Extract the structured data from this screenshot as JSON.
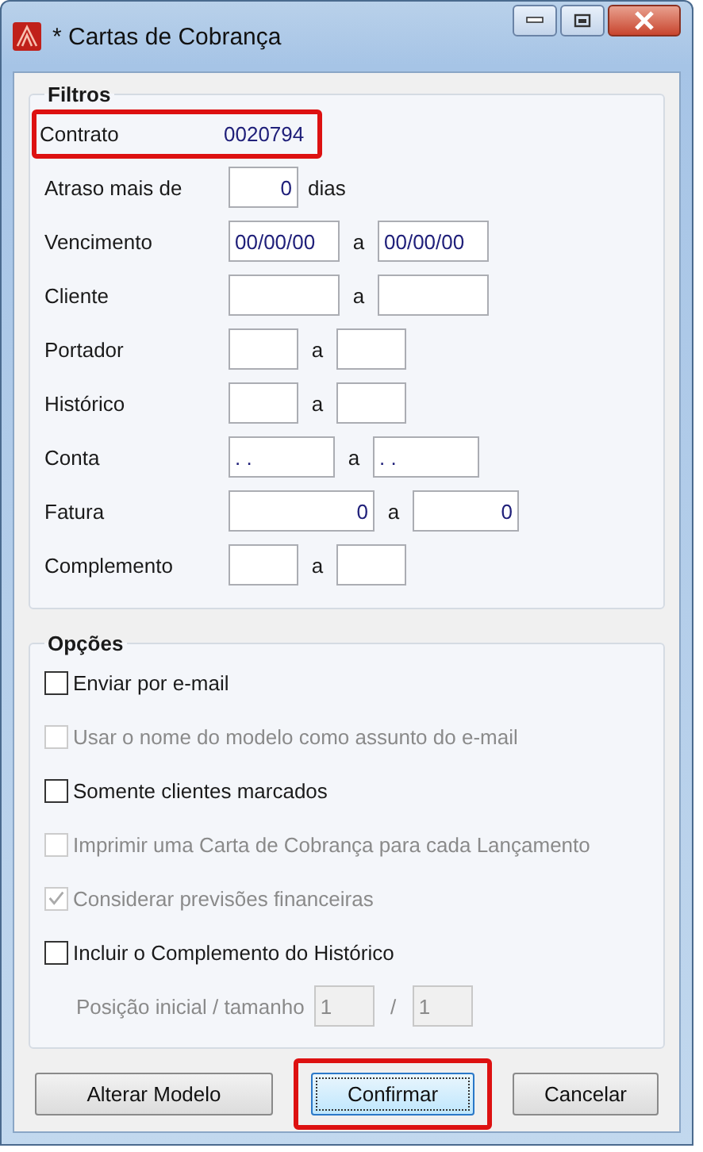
{
  "window": {
    "title": "* Cartas de Cobrança"
  },
  "filters": {
    "title": "Filtros",
    "rows": [
      {
        "kind": "value",
        "label": "Contrato",
        "value": "0020794",
        "highlighted": true
      },
      {
        "kind": "days",
        "label": "Atraso mais de",
        "value": "0",
        "suffix": "dias"
      },
      {
        "kind": "date",
        "label": "Vencimento",
        "from": "00/00/00",
        "separator": "a",
        "to": "00/00/00"
      },
      {
        "kind": "wide",
        "label": "Cliente",
        "separator": "a"
      },
      {
        "kind": "narrow",
        "label": "Portador",
        "separator": "a"
      },
      {
        "kind": "narrow",
        "label": "Histórico",
        "separator": "a"
      },
      {
        "kind": "account",
        "label": "Conta",
        "from": ". .",
        "separator": "a",
        "to": ". ."
      },
      {
        "kind": "number",
        "label": "Fatura",
        "from": "0",
        "separator": "a",
        "to": "0"
      },
      {
        "kind": "narrow",
        "label": "Complemento",
        "separator": "a"
      }
    ]
  },
  "options": {
    "title": "Opções",
    "items": [
      {
        "kind": "checkbox",
        "label": "Enviar por e-mail",
        "checked": false,
        "disabled": false
      },
      {
        "kind": "checkbox",
        "label": "Usar o nome do modelo como assunto do e-mail",
        "checked": false,
        "disabled": true
      },
      {
        "kind": "checkbox",
        "label": "Somente clientes marcados",
        "checked": false,
        "disabled": false
      },
      {
        "kind": "checkbox",
        "label": "Imprimir uma Carta de Cobrança para cada Lançamento",
        "checked": false,
        "disabled": true
      },
      {
        "kind": "checkbox",
        "label": "Considerar previsões financeiras",
        "checked": true,
        "disabled": true
      },
      {
        "kind": "checkbox",
        "label": "Incluir o Complemento do Histórico",
        "checked": false,
        "disabled": false
      },
      {
        "kind": "position",
        "label": "Posição inicial / tamanho",
        "from": "1",
        "separator": "/",
        "to": "1",
        "disabled": true
      }
    ]
  },
  "buttons": [
    {
      "label": "Alterar Modelo",
      "focused": false,
      "highlighted": false
    },
    {
      "label": "Confirmar",
      "focused": true,
      "highlighted": true
    },
    {
      "label": "Cancelar",
      "focused": false,
      "highlighted": false
    }
  ]
}
